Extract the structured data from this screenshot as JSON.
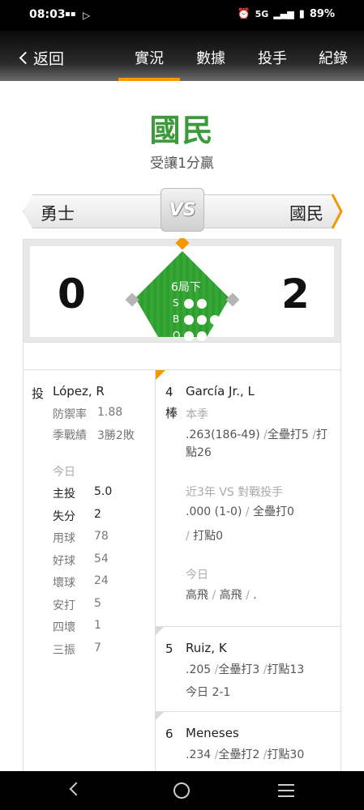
{
  "status": {
    "time": "08:03",
    "network": "5G",
    "battery": "89%"
  },
  "nav": {
    "back_label": "返回",
    "tabs": [
      "實況",
      "數據",
      "投手",
      "紀錄"
    ]
  },
  "header": {
    "team": "國民",
    "subtitle": "受讓1分贏"
  },
  "matchup": {
    "away": "勇士",
    "home": "國民",
    "vs": "VS"
  },
  "score": {
    "away": "0",
    "home": "2",
    "inning": "6局下",
    "sbo": [
      "S",
      "B",
      "O"
    ]
  },
  "pitcher": {
    "tag": "投",
    "name": "López, R",
    "era_label": "防禦率",
    "era": "1.88",
    "record_label": "季戰績",
    "record": "3勝2敗",
    "today_label": "今日",
    "stats": [
      {
        "label": "主投",
        "value": "5.0"
      },
      {
        "label": "失分",
        "value": "2"
      },
      {
        "label": "用球",
        "value": "78"
      },
      {
        "label": "好球",
        "value": "54"
      },
      {
        "label": "壞球",
        "value": "24"
      },
      {
        "label": "安打",
        "value": "5"
      },
      {
        "label": "四壞",
        "value": "1"
      },
      {
        "label": "三振",
        "value": "7"
      }
    ]
  },
  "batters": [
    {
      "order": "4",
      "order_suffix": "棒",
      "name": "García Jr., L",
      "season_label": "本季",
      "season_avg": ".263(186-49)",
      "season_hr": "全壘打5",
      "season_rbi_a": "打",
      "season_rbi_b": "點26",
      "vs_label": "近3年 VS 對戰投手",
      "vs_avg": ".000 (1-0)",
      "vs_hr": "全壘打0",
      "vs_rbi": "打點0",
      "today_label": "今日",
      "today": [
        "高飛",
        "高飛",
        "."
      ]
    },
    {
      "order": "5",
      "name": "Ruiz, K",
      "avg": ".205",
      "hr": "全壘打3",
      "rbi": "打點13",
      "today": "今日 2-1"
    },
    {
      "order": "6",
      "name": "Meneses",
      "avg": ".234",
      "hr": "全壘打2",
      "rbi": "打點30"
    }
  ],
  "colors": {
    "accent": "#f39800",
    "team_green": "#3b9b3b",
    "field_green": "#2e9e2e"
  }
}
